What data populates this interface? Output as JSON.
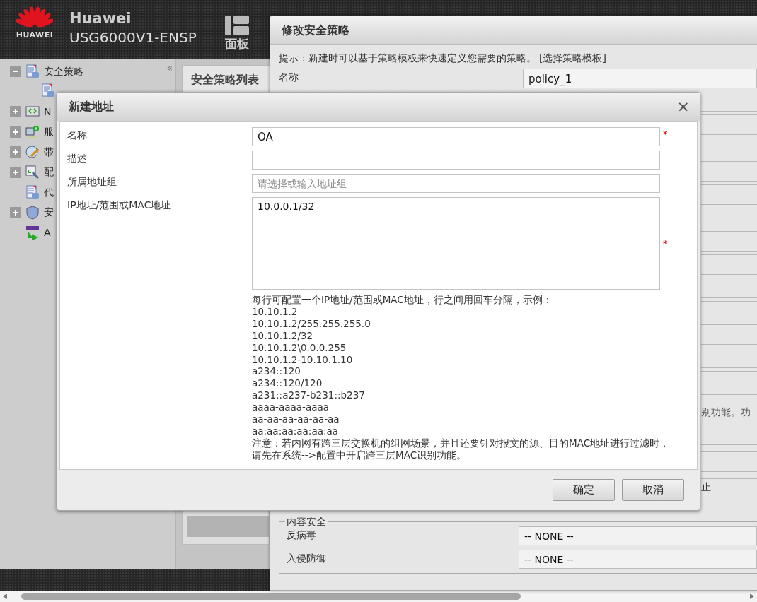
{
  "header": {
    "logo_text": "HUAWEI",
    "brand": "Huawei",
    "device": "USG6000V1-ENSP",
    "panel_button": "面板"
  },
  "sidebar": {
    "collapse": "«",
    "items": [
      {
        "label": "安全策略",
        "kind": "folder",
        "expanded": true
      },
      {
        "label": "N",
        "kind": "folder",
        "expanded": false
      },
      {
        "label": "服",
        "kind": "folder",
        "expanded": false
      },
      {
        "label": "带",
        "kind": "folder",
        "expanded": false
      },
      {
        "label": "配",
        "kind": "folder",
        "expanded": false
      },
      {
        "label": "代",
        "kind": "leaf"
      },
      {
        "label": "安",
        "kind": "folder",
        "expanded": false
      },
      {
        "label": "A",
        "kind": "leaf"
      }
    ]
  },
  "content": {
    "tab": "安全策略列表"
  },
  "policy_dialog": {
    "title": "修改安全策略",
    "hint": "提示：新建时可以基于策略模板来快速定义您需要的策略。",
    "hint_link": "[选择策略模板]",
    "name_label": "名称",
    "name_value": "policy_1",
    "partial_texts": [
      "别功能。功",
      "止"
    ],
    "content_security": {
      "legend": "内容安全",
      "rows": [
        {
          "label": "反病毒",
          "value": "-- NONE --"
        },
        {
          "label": "入侵防御",
          "value": "-- NONE --"
        }
      ]
    }
  },
  "address_dialog": {
    "title": "新建地址",
    "close": "×",
    "required_mark": "*",
    "fields": [
      {
        "label": "名称",
        "kind": "input",
        "value": "OA",
        "required": true
      },
      {
        "label": "描述",
        "kind": "input",
        "required": false
      },
      {
        "label": "所属地址组",
        "kind": "combo",
        "placeholder": "请选择或输入地址组",
        "required": false
      },
      {
        "label": "IP地址/范围或MAC地址",
        "kind": "textarea",
        "value": "10.0.0.1/32",
        "required": true
      }
    ],
    "help_title": "每行可配置一个IP地址/范围或MAC地址，行之间用回车分隔，示例：",
    "examples": [
      "10.10.1.2",
      "10.10.1.2/255.255.255.0",
      "10.10.1.2/32",
      "10.10.1.2\\0.0.0.255",
      "10.10.1.2-10.10.1.10",
      "a234::120",
      "a234::120/120",
      "a231::a237-b231::b237",
      "aaaa-aaaa-aaaa",
      "aa-aa-aa-aa-aa-aa",
      "aa:aa:aa:aa:aa:aa"
    ],
    "note": "注意：若内网有跨三层交换机的组网场景，并且还要针对报文的源、目的MAC地址进行过滤时，请先在系统-->配置中开启跨三层MAC识别功能。",
    "buttons": [
      "确定",
      "取消"
    ]
  }
}
